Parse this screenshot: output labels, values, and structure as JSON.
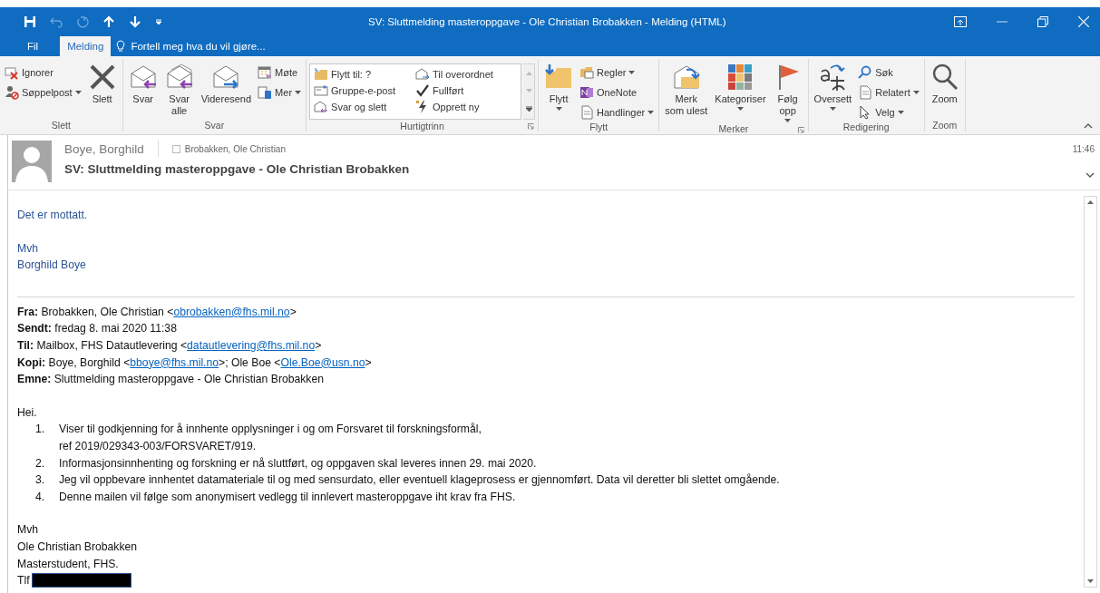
{
  "window": {
    "title": "SV: Sluttmelding masteroppgave - Ole Christian Brobakken - Melding (HTML)"
  },
  "tabs": [
    {
      "label": "Fil",
      "selected": false
    },
    {
      "label": "Melding",
      "selected": true
    }
  ],
  "tell_me": {
    "placeholder": "Fortell meg hva du vil gjøre..."
  },
  "ribbon": {
    "groups": [
      {
        "label": "Slett",
        "launcher": false,
        "items": [
          {
            "kind": "small",
            "label": "Ignorer",
            "dropdown": false
          },
          {
            "kind": "small",
            "label": "Søppelpost",
            "dropdown": true
          },
          {
            "kind": "large",
            "label": "Slett",
            "dropdown": false
          }
        ]
      },
      {
        "label": "Svar",
        "launcher": false,
        "items": [
          {
            "kind": "large",
            "label": "Svar",
            "dropdown": false
          },
          {
            "kind": "large",
            "label": "Svar\nalle",
            "dropdown": false
          },
          {
            "kind": "large",
            "label": "Videresend",
            "dropdown": false
          },
          {
            "kind": "small",
            "label": "Møte",
            "dropdown": false
          },
          {
            "kind": "small",
            "label": "Mer",
            "dropdown": true
          }
        ]
      },
      {
        "label": "Hurtigtrinn",
        "launcher": true,
        "items": [
          {
            "kind": "gallery",
            "label": "Flytt til: ?"
          },
          {
            "kind": "gallery",
            "label": "Til overordnet"
          },
          {
            "kind": "gallery",
            "label": "Gruppe-e-post"
          },
          {
            "kind": "gallery",
            "label": "Fullført"
          },
          {
            "kind": "gallery",
            "label": "Svar og slett"
          },
          {
            "kind": "gallery",
            "label": "Opprett ny"
          }
        ]
      },
      {
        "label": "Flytt",
        "launcher": false,
        "items": [
          {
            "kind": "large",
            "label": "Flytt",
            "dropdown": true
          },
          {
            "kind": "small",
            "label": "Regler",
            "dropdown": true
          },
          {
            "kind": "small",
            "label": "OneNote",
            "dropdown": false
          },
          {
            "kind": "small",
            "label": "Handlinger",
            "dropdown": true
          }
        ]
      },
      {
        "label": "Merker",
        "launcher": true,
        "items": [
          {
            "kind": "large",
            "label": "Merk\nsom ulest",
            "dropdown": false
          },
          {
            "kind": "large",
            "label": "Kategoriser",
            "dropdown": true
          },
          {
            "kind": "large",
            "label": "Følg\nopp",
            "dropdown": true
          }
        ]
      },
      {
        "label": "Redigering",
        "launcher": false,
        "items": [
          {
            "kind": "large",
            "label": "Oversett",
            "dropdown": true
          },
          {
            "kind": "small",
            "label": "Søk",
            "dropdown": false
          },
          {
            "kind": "small",
            "label": "Relatert",
            "dropdown": true
          },
          {
            "kind": "small",
            "label": "Velg",
            "dropdown": true
          }
        ]
      },
      {
        "label": "Zoom",
        "launcher": false,
        "items": [
          {
            "kind": "large",
            "label": "Zoom",
            "dropdown": false
          }
        ]
      }
    ]
  },
  "message": {
    "sender": "Boye, Borghild",
    "recipient": "Brobakken, Ole Christian",
    "subject": "SV: Sluttmelding masteroppgave - Ole Christian Brobakken",
    "time": "11:46"
  },
  "reply": [
    {
      "lines": [
        "Det er mottatt."
      ]
    },
    {
      "lines": [
        "Mvh",
        "Borghild Boye"
      ]
    }
  ],
  "forwarded_header": [
    {
      "label": "Fra:",
      "segments": [
        {
          "kind": "text",
          "text": " Brobakken, Ole Christian <"
        },
        {
          "kind": "link",
          "text": "obrobakken@fhs.mil.no"
        },
        {
          "kind": "text",
          "text": ">"
        }
      ]
    },
    {
      "label": "Sendt:",
      "segments": [
        {
          "kind": "text",
          "text": " fredag 8. mai 2020 11:38"
        }
      ]
    },
    {
      "label": "Til:",
      "segments": [
        {
          "kind": "text",
          "text": " Mailbox, FHS Datautlevering <"
        },
        {
          "kind": "link",
          "text": "datautlevering@fhs.mil.no"
        },
        {
          "kind": "text",
          "text": ">"
        }
      ]
    },
    {
      "label": "Kopi:",
      "segments": [
        {
          "kind": "text",
          "text": " Boye, Borghild <"
        },
        {
          "kind": "link",
          "text": "bboye@fhs.mil.no"
        },
        {
          "kind": "text",
          "text": ">; Ole Boe <"
        },
        {
          "kind": "link",
          "text": "Ole.Boe@usn.no"
        },
        {
          "kind": "text",
          "text": ">"
        }
      ]
    },
    {
      "label": "Emne:",
      "segments": [
        {
          "kind": "text",
          "text": " Sluttmelding masteroppgave - Ole Christian Brobakken"
        }
      ]
    }
  ],
  "body": {
    "greeting": "Hei.",
    "list": [
      {
        "number": "1.",
        "lines": [
          "Viser til godkjenning for å innhente opplysninger i og om Forsvaret til forskningsformål,",
          "ref 2019/029343-003/FORSVARET/919."
        ]
      },
      {
        "number": "2.",
        "lines": [
          "Informasjonsinnhenting og forskning er nå sluttført, og oppgaven skal leveres innen 29. mai 2020."
        ]
      },
      {
        "number": "3.",
        "lines": [
          "Jeg vil oppbevare innhentet datamateriale til og med sensurdato, eller eventuell klageprosess er gjennomført. Data vil deretter bli slettet omgående."
        ]
      },
      {
        "number": "4.",
        "lines": [
          "Denne mailen vil følge som anonymisert vedlegg til innlevert masteroppgave iht krav fra FHS."
        ]
      }
    ],
    "signature": [
      "Mvh",
      "Ole Christian Brobakken",
      "Masterstudent, FHS."
    ],
    "phone_label": "Tlf",
    "phone_redacted": true
  }
}
